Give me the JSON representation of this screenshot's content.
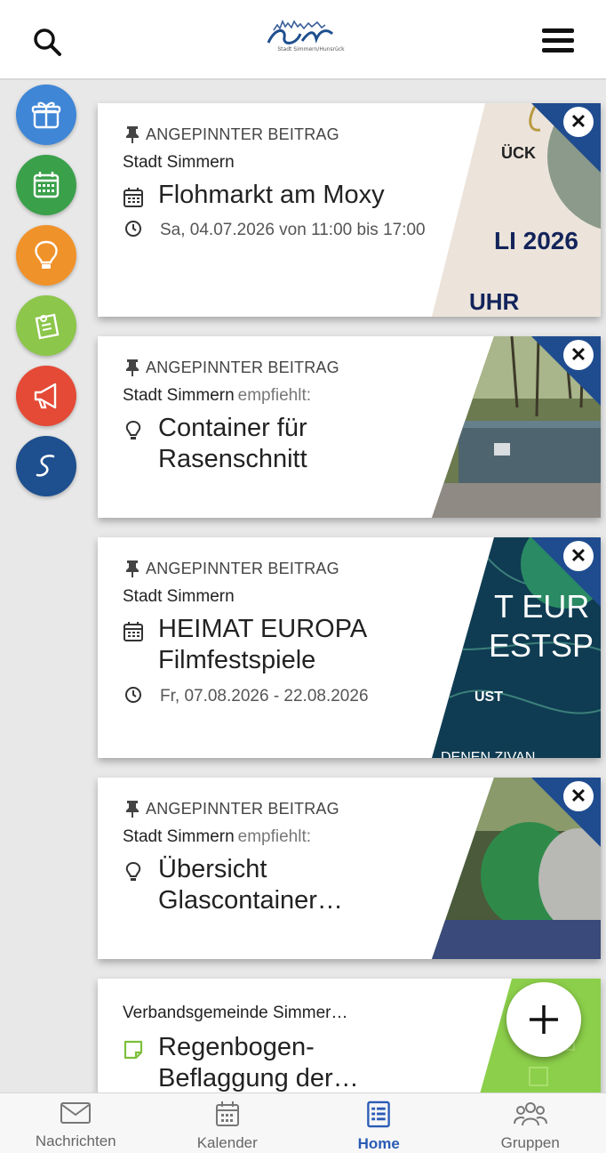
{
  "header": {
    "logo_text": "Stadt Simmern/Hunsrück"
  },
  "rail": [
    {
      "name": "gift",
      "color": "#3f86d6"
    },
    {
      "name": "calendar",
      "color": "#3aa04a"
    },
    {
      "name": "idea",
      "color": "#f0922a"
    },
    {
      "name": "pinboard",
      "color": "#8cc64a"
    },
    {
      "name": "megaphone",
      "color": "#e44a36"
    },
    {
      "name": "simmern",
      "color": "#1e4f8e"
    }
  ],
  "cards": [
    {
      "pinned": "ANGEPINNTER BEITRAG",
      "source": "Stadt Simmern",
      "title": "Flohmarkt am Moxy",
      "date": "Sa, 04.07.2026 von 11:00 bis 17:00",
      "image_text": [
        "ÜCK",
        "LI 2026",
        "UHR"
      ]
    },
    {
      "pinned": "ANGEPINNTER BEITRAG",
      "source": "Stadt Simmern",
      "recommends": "empfiehlt:",
      "title": "Container für Rasenschnitt"
    },
    {
      "pinned": "ANGEPINNTER BEITRAG",
      "source": "Stadt Simmern",
      "title": "HEIMAT EUROPA Filmfestspiele",
      "date": "Fr, 07.08.2026 - 22.08.2026",
      "image_text": [
        "T EUR",
        "ESTSP",
        "UST",
        "DENEN ZIVAN"
      ]
    },
    {
      "pinned": "ANGEPINNTER BEITRAG",
      "source": "Stadt Simmern",
      "recommends": "empfiehlt:",
      "title": "Übersicht Glascontainer…"
    },
    {
      "source": "Verbandsgemeinde Simmer…",
      "title": "Regenbogen-Beflaggung der…"
    }
  ],
  "nav": [
    {
      "label": "Nachrichten",
      "icon": "mail-icon"
    },
    {
      "label": "Kalender",
      "icon": "calendar-icon"
    },
    {
      "label": "Home",
      "icon": "list-icon",
      "active": true
    },
    {
      "label": "Gruppen",
      "icon": "group-icon"
    }
  ],
  "colors": {
    "accent": "#2a5bb5",
    "corner_blue": "#1f4c8f"
  }
}
